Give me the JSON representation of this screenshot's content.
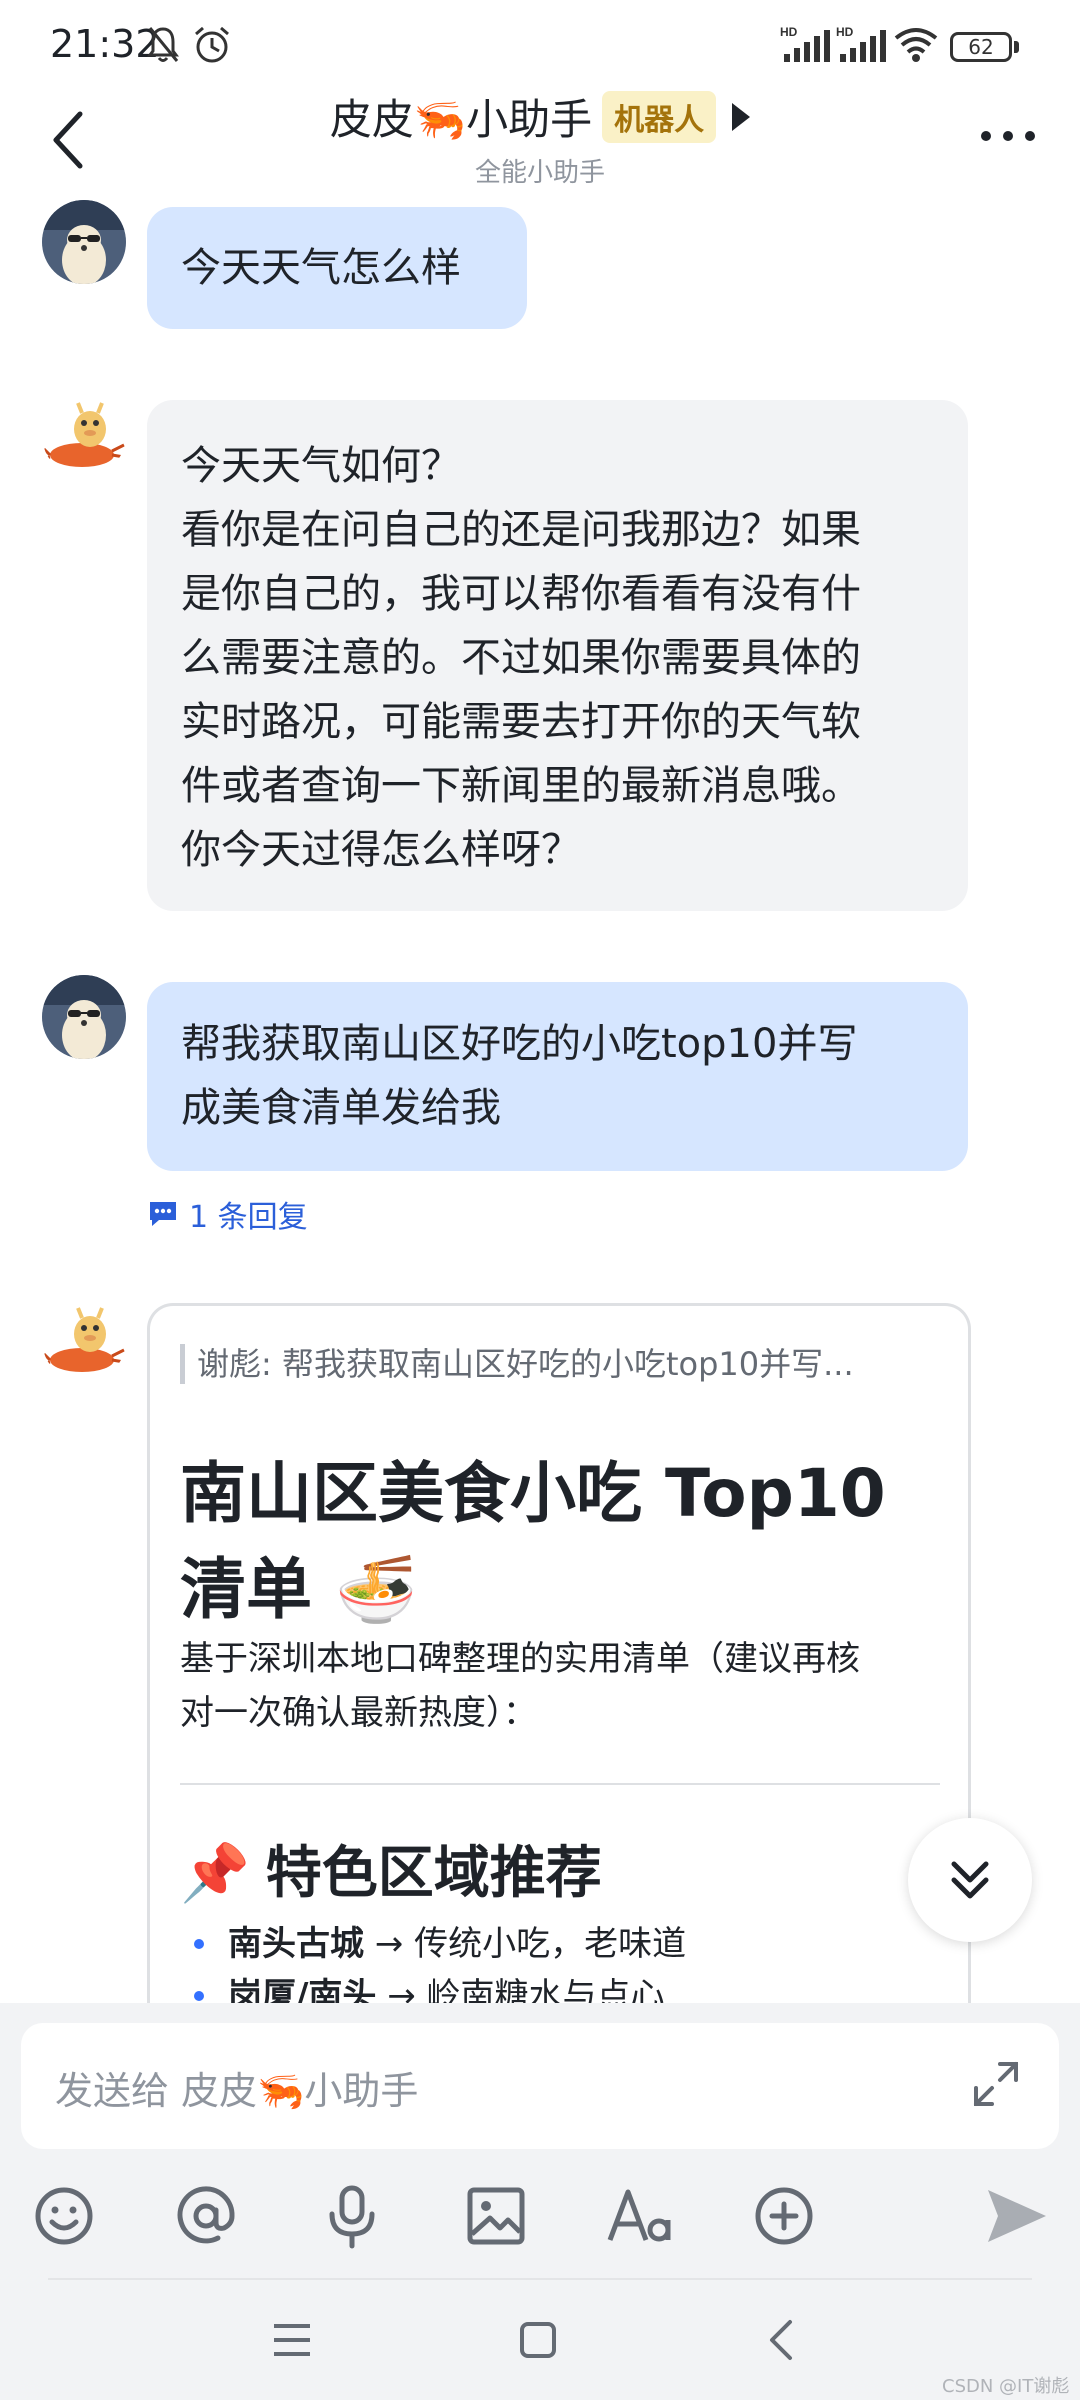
{
  "status_bar": {
    "time": "21:32",
    "battery": "62",
    "icons": [
      "bell-mute-icon",
      "alarm-icon",
      "hd-signal-icon",
      "hd-signal-icon",
      "wifi-icon",
      "battery-icon"
    ]
  },
  "header": {
    "title": "皮皮🦐小助手",
    "badge": "机器人",
    "subtitle": "全能小助手"
  },
  "messages": [
    {
      "sender": "user",
      "lines": [
        "今天天气怎么样"
      ]
    },
    {
      "sender": "bot",
      "lines": [
        "今天天气如何？",
        "看你是在问自己的还是问我那边？如果",
        "是你自己的，我可以帮你看看有没有什",
        "么需要注意的。不过如果你需要具体的",
        "实时路况，可能需要去打开你的天气软",
        "件或者查询一下新闻里的最新消息哦。",
        "你今天过得怎么样呀？"
      ]
    },
    {
      "sender": "user",
      "lines": [
        "帮我获取南山区好吃的小吃top10并写",
        "成美食清单发给我"
      ],
      "reply_label": "1 条回复"
    }
  ],
  "card": {
    "quote": "谢彪: 帮我获取南山区好吃的小吃top10并写...",
    "title_line1": "南山区美食小吃 Top10",
    "title_line2": "清单 🍜",
    "desc_line1": "基于深圳本地口碑整理的实用清单（建议再核",
    "desc_line2": "对一次确认最新热度）：",
    "section": "特色区域推荐",
    "section_emoji": "📌",
    "items": [
      {
        "bold": "南头古城",
        "rest": " → 传统小吃，老味道"
      },
      {
        "bold": "岗厦/南头",
        "rest": " → 岭南糖水与点心"
      }
    ]
  },
  "input": {
    "placeholder": "发送给 皮皮🦐小助手"
  },
  "toolbar": [
    "emoji-icon",
    "at-icon",
    "microphone-icon",
    "image-icon",
    "font-format-icon",
    "plus-icon",
    "send-icon"
  ],
  "navbar": [
    "menu-icon",
    "home-icon",
    "back-icon"
  ],
  "watermark": "CSDN @IT谢彪",
  "colors": {
    "accent": "#3370ff",
    "user_bubble": "#d6e6ff",
    "bot_bubble": "#f2f3f5",
    "badge_bg": "#faf1c7",
    "badge_text": "#a4730b"
  }
}
